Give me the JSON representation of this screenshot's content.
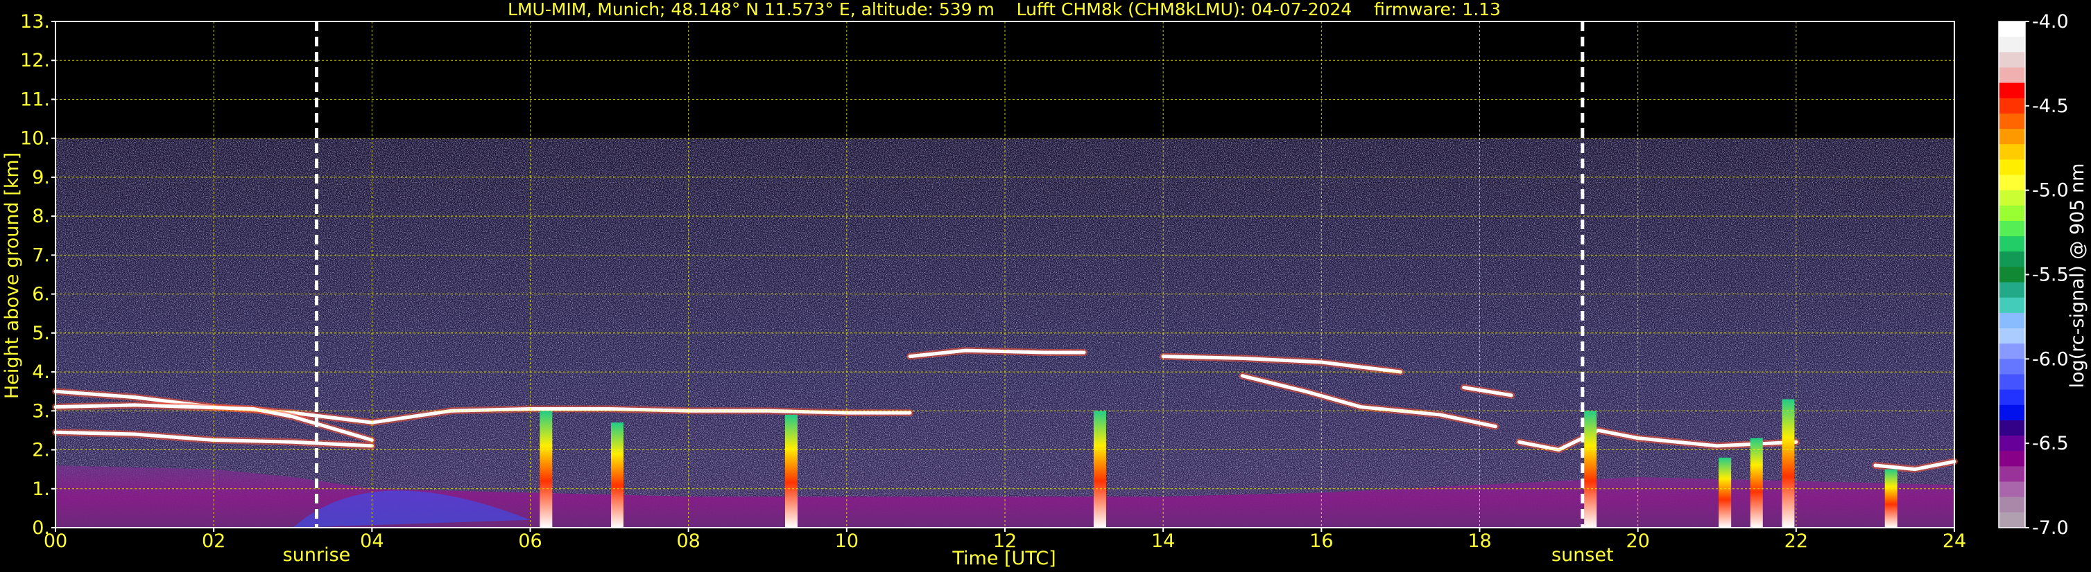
{
  "chart_data": {
    "type": "heatmap",
    "title": "LMU-MIM, Munich; 48.148° N 11.573° E, altitude: 539 m    Lufft CHM8k (CHM8kLMU): 04-07-2024    firmware: 1.13",
    "xlabel": "Time [UTC]",
    "ylabel": "Height above ground [km]",
    "xlim": [
      0,
      24
    ],
    "ylim": [
      0,
      13
    ],
    "x_ticks": [
      "00",
      "02",
      "04",
      "06",
      "08",
      "10",
      "12",
      "14",
      "16",
      "18",
      "20",
      "22",
      "24"
    ],
    "y_ticks": [
      "0.",
      "1.",
      "2.",
      "3.",
      "4.",
      "5.",
      "6.",
      "7.",
      "8.",
      "9.",
      "10.",
      "11.",
      "12.",
      "13."
    ],
    "grid": true,
    "grid_color": "#ffff00",
    "data_top_km": 10,
    "annotations": [
      {
        "label": "sunrise",
        "x": 3.3
      },
      {
        "label": "sunset",
        "x": 19.3
      }
    ],
    "colorbar": {
      "label": "log(rc-signal) @ 905 nm",
      "range": [
        -7.0,
        -4.0
      ],
      "ticks": [
        "-4.0",
        "-4.5",
        "-5.0",
        "-5.5",
        "-6.0",
        "-6.5",
        "-7.0"
      ],
      "colors": [
        "#ffffff",
        "#f2f2f2",
        "#e8d0d0",
        "#f0b0b0",
        "#ff0000",
        "#ff3300",
        "#ff6600",
        "#ff9900",
        "#ffcc00",
        "#ffee00",
        "#ffff33",
        "#ccff33",
        "#99ff33",
        "#55ee55",
        "#22cc66",
        "#119955",
        "#118833",
        "#22aa88",
        "#44ccbb",
        "#88bbff",
        "#aaccff",
        "#8899ff",
        "#6677ff",
        "#4455ff",
        "#2233ff",
        "#0011ee",
        "#330088",
        "#660099",
        "#880088",
        "#993399",
        "#aa66aa",
        "#aa88aa",
        "#b0a0b0"
      ]
    },
    "layers": [
      {
        "name": "cloud-layer",
        "points": [
          [
            0,
            3.5
          ],
          [
            1,
            3.35
          ],
          [
            2,
            3.1
          ],
          [
            3,
            2.95
          ],
          [
            4,
            2.7
          ],
          [
            5,
            3.0
          ],
          [
            6,
            3.05
          ],
          [
            7,
            3.05
          ],
          [
            8,
            3.0
          ],
          [
            9,
            3.0
          ],
          [
            10,
            2.95
          ],
          [
            10.8,
            2.95
          ]
        ]
      },
      {
        "name": "cloud-layer",
        "points": [
          [
            0,
            3.1
          ],
          [
            1,
            3.15
          ],
          [
            2.5,
            3.05
          ],
          [
            3,
            2.85
          ],
          [
            4,
            2.25
          ]
        ]
      },
      {
        "name": "cloud-layer",
        "points": [
          [
            0,
            2.45
          ],
          [
            1,
            2.4
          ],
          [
            2,
            2.25
          ],
          [
            3,
            2.2
          ],
          [
            4,
            2.1
          ]
        ]
      },
      {
        "name": "cloud-layer",
        "points": [
          [
            10.8,
            4.4
          ],
          [
            11.5,
            4.55
          ],
          [
            12.5,
            4.5
          ],
          [
            13,
            4.5
          ]
        ]
      },
      {
        "name": "cloud-layer",
        "points": [
          [
            14,
            4.4
          ],
          [
            15,
            4.35
          ],
          [
            16,
            4.25
          ],
          [
            17,
            4.0
          ]
        ]
      },
      {
        "name": "cloud-layer",
        "points": [
          [
            15,
            3.9
          ],
          [
            15.8,
            3.5
          ],
          [
            16.5,
            3.1
          ],
          [
            17.5,
            2.9
          ],
          [
            18.2,
            2.6
          ]
        ]
      },
      {
        "name": "cloud-layer",
        "points": [
          [
            17.8,
            3.6
          ],
          [
            18.4,
            3.4
          ]
        ]
      },
      {
        "name": "cloud-layer",
        "points": [
          [
            18.5,
            2.2
          ],
          [
            19,
            2.0
          ],
          [
            19.5,
            2.5
          ],
          [
            20,
            2.3
          ],
          [
            21,
            2.1
          ],
          [
            22,
            2.2
          ]
        ]
      },
      {
        "name": "cloud-layer",
        "points": [
          [
            23,
            1.6
          ],
          [
            23.5,
            1.5
          ],
          [
            24,
            1.7
          ]
        ]
      }
    ],
    "columns": [
      {
        "name": "precipitation",
        "x": 6.2,
        "top": 3.0
      },
      {
        "name": "precipitation",
        "x": 7.1,
        "top": 2.7
      },
      {
        "name": "precipitation",
        "x": 9.3,
        "top": 2.9
      },
      {
        "name": "precipitation",
        "x": 13.2,
        "top": 3.0
      },
      {
        "name": "precipitation",
        "x": 19.4,
        "top": 3.0
      },
      {
        "name": "precipitation",
        "x": 21.1,
        "top": 1.8
      },
      {
        "name": "precipitation",
        "x": 21.5,
        "top": 2.3
      },
      {
        "name": "precipitation",
        "x": 21.9,
        "top": 3.3
      },
      {
        "name": "precipitation",
        "x": 23.2,
        "top": 1.5
      }
    ]
  }
}
